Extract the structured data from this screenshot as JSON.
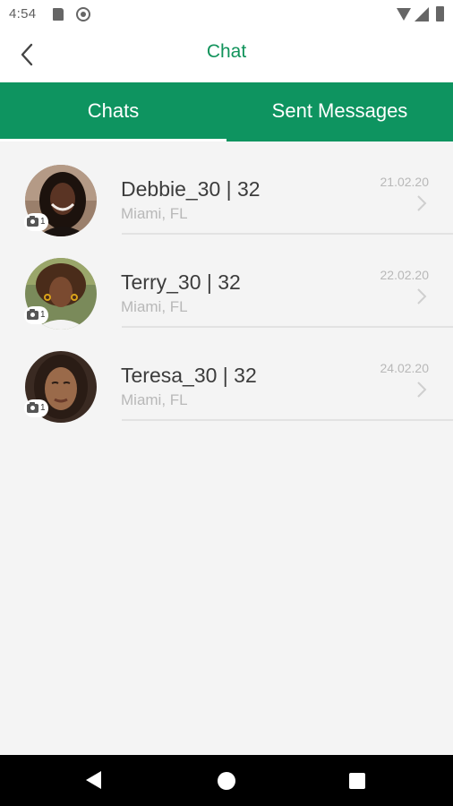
{
  "status_bar": {
    "time": "4:54"
  },
  "header": {
    "title": "Chat"
  },
  "tabs": [
    {
      "label": "Chats",
      "selected": true
    },
    {
      "label": "Sent Messages",
      "selected": false
    }
  ],
  "chats": [
    {
      "name": "Debbie_30 | 32",
      "location": "Miami, FL",
      "date": "21.02.20",
      "photo_count": "1"
    },
    {
      "name": "Terry_30 | 32",
      "location": "Miami, FL",
      "date": "22.02.20",
      "photo_count": "1"
    },
    {
      "name": "Teresa_30 | 32",
      "location": "Miami, FL",
      "date": "24.02.20",
      "photo_count": "1"
    }
  ],
  "colors": {
    "accent": "#0e9460",
    "title": "#11935b",
    "background": "#f4f4f4"
  },
  "icons": [
    "back-arrow-icon",
    "sd-card-icon",
    "sync-icon",
    "wifi-icon",
    "signal-icon",
    "battery-icon",
    "camera-icon",
    "chevron-right-icon",
    "nav-back-icon",
    "nav-home-icon",
    "nav-recents-icon"
  ]
}
